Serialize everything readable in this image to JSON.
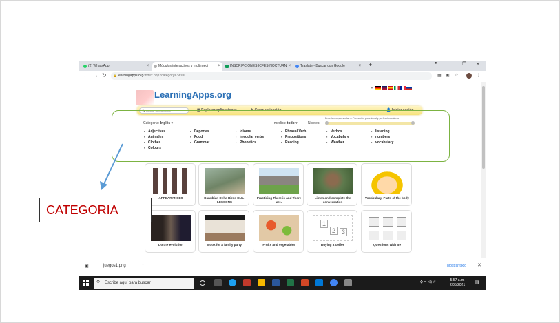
{
  "browser": {
    "tabs": [
      {
        "label": "(2) WhatsApp",
        "color": "#25d366",
        "active": false
      },
      {
        "label": "Módulos interactivos y multimedi",
        "color": "#b0b0b0",
        "active": true
      },
      {
        "label": "INSCRIPCIONES ICFES-NOCTURN",
        "color": "#0f9d58",
        "active": false
      },
      {
        "label": "Traslate - Buscar con Google",
        "color": "#4285f4",
        "active": false
      }
    ],
    "tab_close": "×",
    "new_tab": "+",
    "window_controls": {
      "minimize": "−",
      "restore": "❐",
      "close": "✕"
    },
    "url_host": "learningapps.org",
    "url_path": "/index.php?category=3&s="
  },
  "site": {
    "logo": "LearningApps.org",
    "nav": {
      "search_placeholder": "Buscar aplicaciones",
      "explore": "Explorar aplicaciones",
      "create": "Crear aplicación",
      "login": "Iniciar sesión"
    },
    "filters": {
      "category_label": "Categoría:",
      "category_value": "Inglés",
      "medios_label": "medios:",
      "medios_value": "todo",
      "levels_label": "Niveles:",
      "levels_note": "Enseñanza preescolar — Formación profesional y perfeccionamiento"
    },
    "subcategories": [
      [
        "Adjectives",
        "Animales",
        "Clothes",
        "Colours"
      ],
      [
        "Deportes",
        "Food",
        "Grammar"
      ],
      [
        "Idioms",
        "Irregular verbs",
        "Phonetics"
      ],
      [
        "Phrasal Verb",
        "Prepositions",
        "Reading"
      ],
      [
        "Verbos",
        "Vocabulary",
        "Weather"
      ],
      [
        "listening",
        "numbers",
        "vocabulary"
      ]
    ],
    "apps_row1": [
      {
        "title": "APPEARANCES"
      },
      {
        "title": "Danubian Delta Birds CLIL-LESSONS"
      },
      {
        "title": "Practicing There is and There are."
      },
      {
        "title": "Listen and complete the conversation"
      },
      {
        "title": "Vocabulary. Parts of the body"
      }
    ],
    "apps_row2": [
      {
        "title": "Do the evolution"
      },
      {
        "title": "Book for a family party"
      },
      {
        "title": "Fruits and vegetables"
      },
      {
        "title": "Buying a coffee"
      },
      {
        "title": "Questions with Be"
      }
    ]
  },
  "downloads": {
    "file": "juegos1.png",
    "show_all": "Mostrar todo"
  },
  "taskbar": {
    "search": "Escribe aquí para buscar",
    "time": "5:57 a.m.",
    "date": "2/05/2021"
  },
  "annotation": {
    "label": "CATEGORIA",
    "color": "#c00000"
  }
}
